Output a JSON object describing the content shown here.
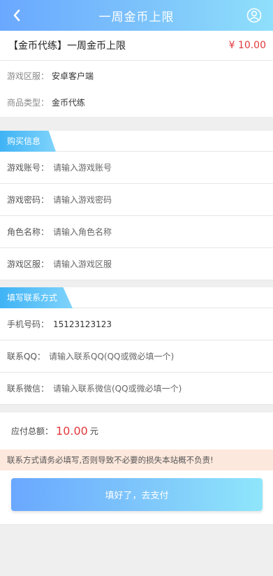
{
  "header": {
    "title": "一周金币上限",
    "back_icon": "chevron-left-icon",
    "user_icon": "user-circle-icon"
  },
  "product": {
    "name": "【金币代练】一周金币上限",
    "price": "¥ 10.00",
    "server_label": "游戏区服：",
    "server_value": "安卓客户端",
    "type_label": "商品类型：",
    "type_value": "金币代练"
  },
  "purchase": {
    "section_title": "购买信息",
    "fields": [
      {
        "label": "游戏账号：",
        "placeholder": "请输入游戏账号",
        "value": ""
      },
      {
        "label": "游戏密码：",
        "placeholder": "请输入游戏密码",
        "value": ""
      },
      {
        "label": "角色名称：",
        "placeholder": "请输入角色名称",
        "value": ""
      },
      {
        "label": "游戏区服：",
        "placeholder": "请输入游戏区服",
        "value": ""
      }
    ]
  },
  "contact": {
    "section_title": "填写联系方式",
    "phone_label": "手机号码：",
    "phone_value": "15123123123",
    "qq_label": "联系QQ：",
    "qq_placeholder": "请输入联系QQ(QQ或微必填一个)",
    "wechat_label": "联系微信：",
    "wechat_placeholder": "请输入联系微信(QQ或微必填一个)"
  },
  "total": {
    "label": "应付总额：",
    "amount": "10.00",
    "unit": "元"
  },
  "notice": "联系方式请务必填写,否则导致不必要的损失本站概不负责!",
  "pay_button": "填好了，去支付",
  "colors": {
    "accent": "#7dc4fb",
    "price": "#e4393c",
    "notice_bg": "#fde8dd"
  }
}
